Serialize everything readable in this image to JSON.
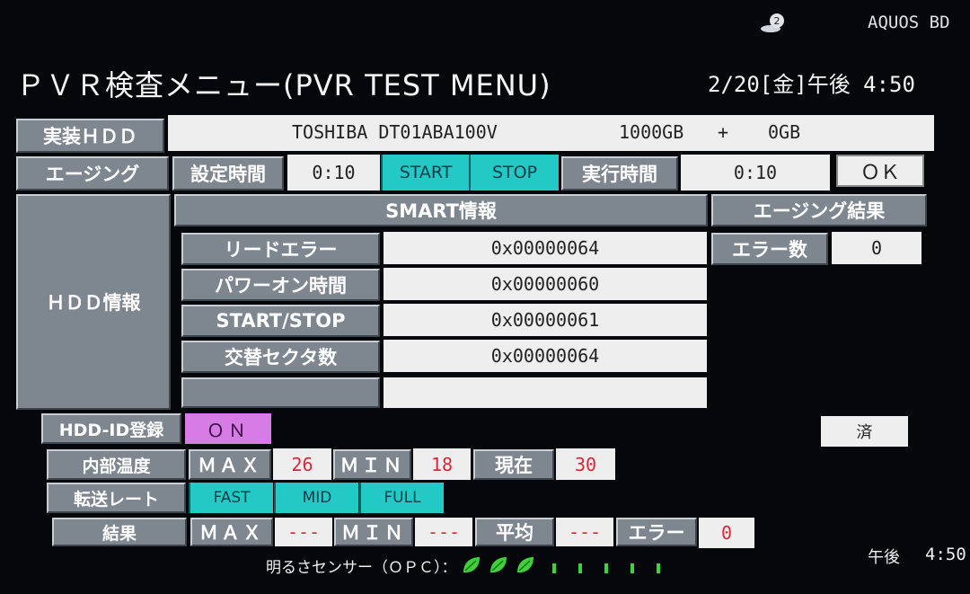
{
  "top_icon": "disc-2-icon",
  "brand": "AQUOS BD",
  "title": "ＰＶＲ検査メニュー(PVR TEST MENU)",
  "datetime": "2/20[金]午後 4:50",
  "hdd": {
    "label": "実装ＨＤＤ",
    "model": "TOSHIBA DT01ABA100V",
    "capacity": "1000GB",
    "plus": "+",
    "capacity2": "0GB"
  },
  "aging": {
    "label": "エージング",
    "set_time_label": "設定時間",
    "set_time": "0:10",
    "start": "START",
    "stop": "STOP",
    "run_time_label": "実行時間",
    "run_time": "0:10",
    "ok": "ＯＫ"
  },
  "hdd_info": {
    "label": "ＨＤＤ情報",
    "smart_header": "SMART情報",
    "rows": [
      {
        "label": "リードエラー",
        "value": "0x00000064"
      },
      {
        "label": "パワーオン時間",
        "value": "0x00000060"
      },
      {
        "label": "START/STOP",
        "value": "0x00000061"
      },
      {
        "label": "交替セクタ数",
        "value": "0x00000064"
      },
      {
        "label": "",
        "value": ""
      }
    ],
    "aging_result_header": "エージング結果",
    "error_count_label": "エラー数",
    "error_count": "0"
  },
  "hdd_id": {
    "label": "HDD-ID登録",
    "value": "ＯＮ",
    "done": "済"
  },
  "temp": {
    "label": "内部温度",
    "max_label": "ＭＡＸ",
    "max": "26",
    "min_label": "ＭＩＮ",
    "min": "18",
    "now_label": "現在",
    "now": "30"
  },
  "rate": {
    "label": "転送レート",
    "fast": "FAST",
    "mid": "MID",
    "full": "FULL"
  },
  "result": {
    "label": "結果",
    "max_label": "ＭＡＸ",
    "max": "---",
    "min_label": "ＭＩＮ",
    "min": "---",
    "avg_label": "平均",
    "avg": "---",
    "err_label": "エラー",
    "err": "0"
  },
  "opc": {
    "label": "明るさセンサー（ＯＰＣ）：",
    "leaves": 3,
    "bars": 5,
    "leaf_color": "#3fd13b"
  },
  "clock": {
    "period": "午後",
    "time": "4:50"
  }
}
